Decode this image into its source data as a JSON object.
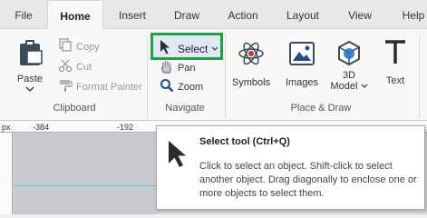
{
  "menu": {
    "tabs": [
      {
        "label": "File",
        "active": false
      },
      {
        "label": "Home",
        "active": true
      },
      {
        "label": "Insert",
        "active": false
      },
      {
        "label": "Draw",
        "active": false
      },
      {
        "label": "Action",
        "active": false
      },
      {
        "label": "Layout",
        "active": false
      },
      {
        "label": "View",
        "active": false
      },
      {
        "label": "Help",
        "active": false
      }
    ]
  },
  "ribbon": {
    "clipboard": {
      "paste_label": "Paste",
      "copy_label": "Copy",
      "cut_label": "Cut",
      "format_painter_label": "Format Painter",
      "group_label": "Clipboard"
    },
    "navigate": {
      "select_label": "Select",
      "pan_label": "Pan",
      "zoom_label": "Zoom",
      "group_label": "Navigate"
    },
    "place_draw": {
      "symbols_label": "Symbols",
      "images_label": "Images",
      "model3d_label_line1": "3D",
      "model3d_label_line2": "Model",
      "text_label": "Text",
      "group_label": "Place & Draw"
    }
  },
  "ruler": {
    "unit": "px",
    "ticks": [
      "-384",
      "-192"
    ]
  },
  "tooltip": {
    "title": "Select tool (Ctrl+Q)",
    "body": "Click to select an object. Shift-click to select another object. Drag diagonally to enclose one or more objects to select them."
  },
  "colors": {
    "highlight_border": "#1aa541",
    "guide_line": "#3fd4e6"
  }
}
